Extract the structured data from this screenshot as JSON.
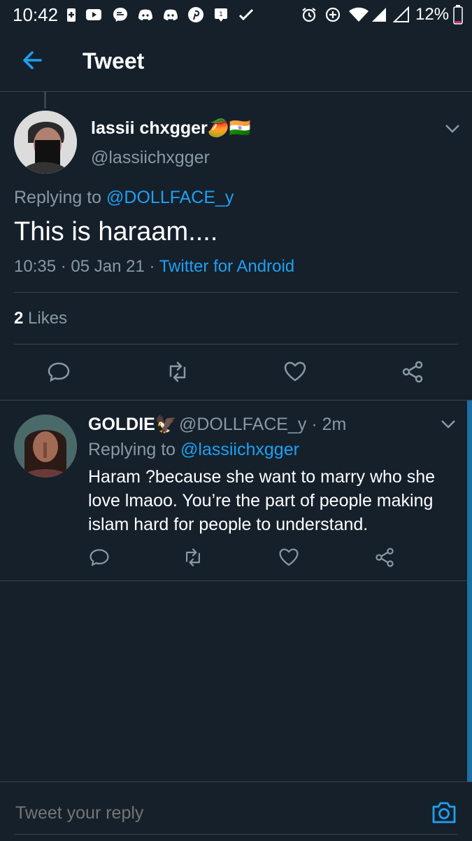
{
  "status_bar": {
    "time": "10:42",
    "battery": "12%",
    "icons": [
      "battery-saver-icon",
      "youtube-icon",
      "messenger-icon",
      "discord-icon",
      "discord-icon",
      "pinterest-icon",
      "notification-icon",
      "check-icon",
      "alarm-icon",
      "data-saver-icon",
      "wifi-icon",
      "signal-icon",
      "signal-icon",
      "battery-icon"
    ]
  },
  "app_bar": {
    "title": "Tweet"
  },
  "main_tweet": {
    "display_name": "lassii chxgger",
    "name_emoji": "🥭🇮🇳",
    "handle": "@lassiichxgger",
    "replying_prefix": "Replying to",
    "replying_to": "@DOLLFACE_y",
    "text": "This is haraam....",
    "time": "10:35",
    "date": "05 Jan 21",
    "source": "Twitter for Android",
    "likes_count": "2",
    "likes_label": "Likes"
  },
  "reply": {
    "display_name": "GOLDIE",
    "name_emoji": "🦅",
    "handle": "@DOLLFACE_y",
    "age": "· 2m",
    "replying_prefix": "Replying to",
    "replying_to": "@lassiichxgger",
    "text": "Haram ?because she want to marry who she love lmaoo. You’re the part of people making islam hard for people to understand."
  },
  "compose": {
    "placeholder": "Tweet your reply"
  },
  "colors": {
    "background": "#15202b",
    "accent": "#1da1f2",
    "muted": "#8899a6",
    "divider": "#38444d"
  }
}
